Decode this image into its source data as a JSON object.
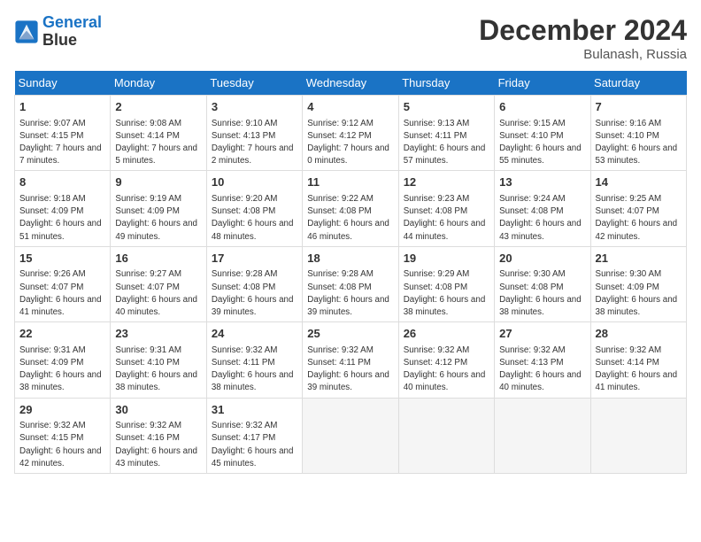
{
  "header": {
    "logo_line1": "General",
    "logo_line2": "Blue",
    "month": "December 2024",
    "location": "Bulanash, Russia"
  },
  "days_of_week": [
    "Sunday",
    "Monday",
    "Tuesday",
    "Wednesday",
    "Thursday",
    "Friday",
    "Saturday"
  ],
  "weeks": [
    [
      {
        "day": "1",
        "sunrise": "Sunrise: 9:07 AM",
        "sunset": "Sunset: 4:15 PM",
        "daylight": "Daylight: 7 hours and 7 minutes."
      },
      {
        "day": "2",
        "sunrise": "Sunrise: 9:08 AM",
        "sunset": "Sunset: 4:14 PM",
        "daylight": "Daylight: 7 hours and 5 minutes."
      },
      {
        "day": "3",
        "sunrise": "Sunrise: 9:10 AM",
        "sunset": "Sunset: 4:13 PM",
        "daylight": "Daylight: 7 hours and 2 minutes."
      },
      {
        "day": "4",
        "sunrise": "Sunrise: 9:12 AM",
        "sunset": "Sunset: 4:12 PM",
        "daylight": "Daylight: 7 hours and 0 minutes."
      },
      {
        "day": "5",
        "sunrise": "Sunrise: 9:13 AM",
        "sunset": "Sunset: 4:11 PM",
        "daylight": "Daylight: 6 hours and 57 minutes."
      },
      {
        "day": "6",
        "sunrise": "Sunrise: 9:15 AM",
        "sunset": "Sunset: 4:10 PM",
        "daylight": "Daylight: 6 hours and 55 minutes."
      },
      {
        "day": "7",
        "sunrise": "Sunrise: 9:16 AM",
        "sunset": "Sunset: 4:10 PM",
        "daylight": "Daylight: 6 hours and 53 minutes."
      }
    ],
    [
      {
        "day": "8",
        "sunrise": "Sunrise: 9:18 AM",
        "sunset": "Sunset: 4:09 PM",
        "daylight": "Daylight: 6 hours and 51 minutes."
      },
      {
        "day": "9",
        "sunrise": "Sunrise: 9:19 AM",
        "sunset": "Sunset: 4:09 PM",
        "daylight": "Daylight: 6 hours and 49 minutes."
      },
      {
        "day": "10",
        "sunrise": "Sunrise: 9:20 AM",
        "sunset": "Sunset: 4:08 PM",
        "daylight": "Daylight: 6 hours and 48 minutes."
      },
      {
        "day": "11",
        "sunrise": "Sunrise: 9:22 AM",
        "sunset": "Sunset: 4:08 PM",
        "daylight": "Daylight: 6 hours and 46 minutes."
      },
      {
        "day": "12",
        "sunrise": "Sunrise: 9:23 AM",
        "sunset": "Sunset: 4:08 PM",
        "daylight": "Daylight: 6 hours and 44 minutes."
      },
      {
        "day": "13",
        "sunrise": "Sunrise: 9:24 AM",
        "sunset": "Sunset: 4:08 PM",
        "daylight": "Daylight: 6 hours and 43 minutes."
      },
      {
        "day": "14",
        "sunrise": "Sunrise: 9:25 AM",
        "sunset": "Sunset: 4:07 PM",
        "daylight": "Daylight: 6 hours and 42 minutes."
      }
    ],
    [
      {
        "day": "15",
        "sunrise": "Sunrise: 9:26 AM",
        "sunset": "Sunset: 4:07 PM",
        "daylight": "Daylight: 6 hours and 41 minutes."
      },
      {
        "day": "16",
        "sunrise": "Sunrise: 9:27 AM",
        "sunset": "Sunset: 4:07 PM",
        "daylight": "Daylight: 6 hours and 40 minutes."
      },
      {
        "day": "17",
        "sunrise": "Sunrise: 9:28 AM",
        "sunset": "Sunset: 4:08 PM",
        "daylight": "Daylight: 6 hours and 39 minutes."
      },
      {
        "day": "18",
        "sunrise": "Sunrise: 9:28 AM",
        "sunset": "Sunset: 4:08 PM",
        "daylight": "Daylight: 6 hours and 39 minutes."
      },
      {
        "day": "19",
        "sunrise": "Sunrise: 9:29 AM",
        "sunset": "Sunset: 4:08 PM",
        "daylight": "Daylight: 6 hours and 38 minutes."
      },
      {
        "day": "20",
        "sunrise": "Sunrise: 9:30 AM",
        "sunset": "Sunset: 4:08 PM",
        "daylight": "Daylight: 6 hours and 38 minutes."
      },
      {
        "day": "21",
        "sunrise": "Sunrise: 9:30 AM",
        "sunset": "Sunset: 4:09 PM",
        "daylight": "Daylight: 6 hours and 38 minutes."
      }
    ],
    [
      {
        "day": "22",
        "sunrise": "Sunrise: 9:31 AM",
        "sunset": "Sunset: 4:09 PM",
        "daylight": "Daylight: 6 hours and 38 minutes."
      },
      {
        "day": "23",
        "sunrise": "Sunrise: 9:31 AM",
        "sunset": "Sunset: 4:10 PM",
        "daylight": "Daylight: 6 hours and 38 minutes."
      },
      {
        "day": "24",
        "sunrise": "Sunrise: 9:32 AM",
        "sunset": "Sunset: 4:11 PM",
        "daylight": "Daylight: 6 hours and 38 minutes."
      },
      {
        "day": "25",
        "sunrise": "Sunrise: 9:32 AM",
        "sunset": "Sunset: 4:11 PM",
        "daylight": "Daylight: 6 hours and 39 minutes."
      },
      {
        "day": "26",
        "sunrise": "Sunrise: 9:32 AM",
        "sunset": "Sunset: 4:12 PM",
        "daylight": "Daylight: 6 hours and 40 minutes."
      },
      {
        "day": "27",
        "sunrise": "Sunrise: 9:32 AM",
        "sunset": "Sunset: 4:13 PM",
        "daylight": "Daylight: 6 hours and 40 minutes."
      },
      {
        "day": "28",
        "sunrise": "Sunrise: 9:32 AM",
        "sunset": "Sunset: 4:14 PM",
        "daylight": "Daylight: 6 hours and 41 minutes."
      }
    ],
    [
      {
        "day": "29",
        "sunrise": "Sunrise: 9:32 AM",
        "sunset": "Sunset: 4:15 PM",
        "daylight": "Daylight: 6 hours and 42 minutes."
      },
      {
        "day": "30",
        "sunrise": "Sunrise: 9:32 AM",
        "sunset": "Sunset: 4:16 PM",
        "daylight": "Daylight: 6 hours and 43 minutes."
      },
      {
        "day": "31",
        "sunrise": "Sunrise: 9:32 AM",
        "sunset": "Sunset: 4:17 PM",
        "daylight": "Daylight: 6 hours and 45 minutes."
      },
      null,
      null,
      null,
      null
    ]
  ]
}
